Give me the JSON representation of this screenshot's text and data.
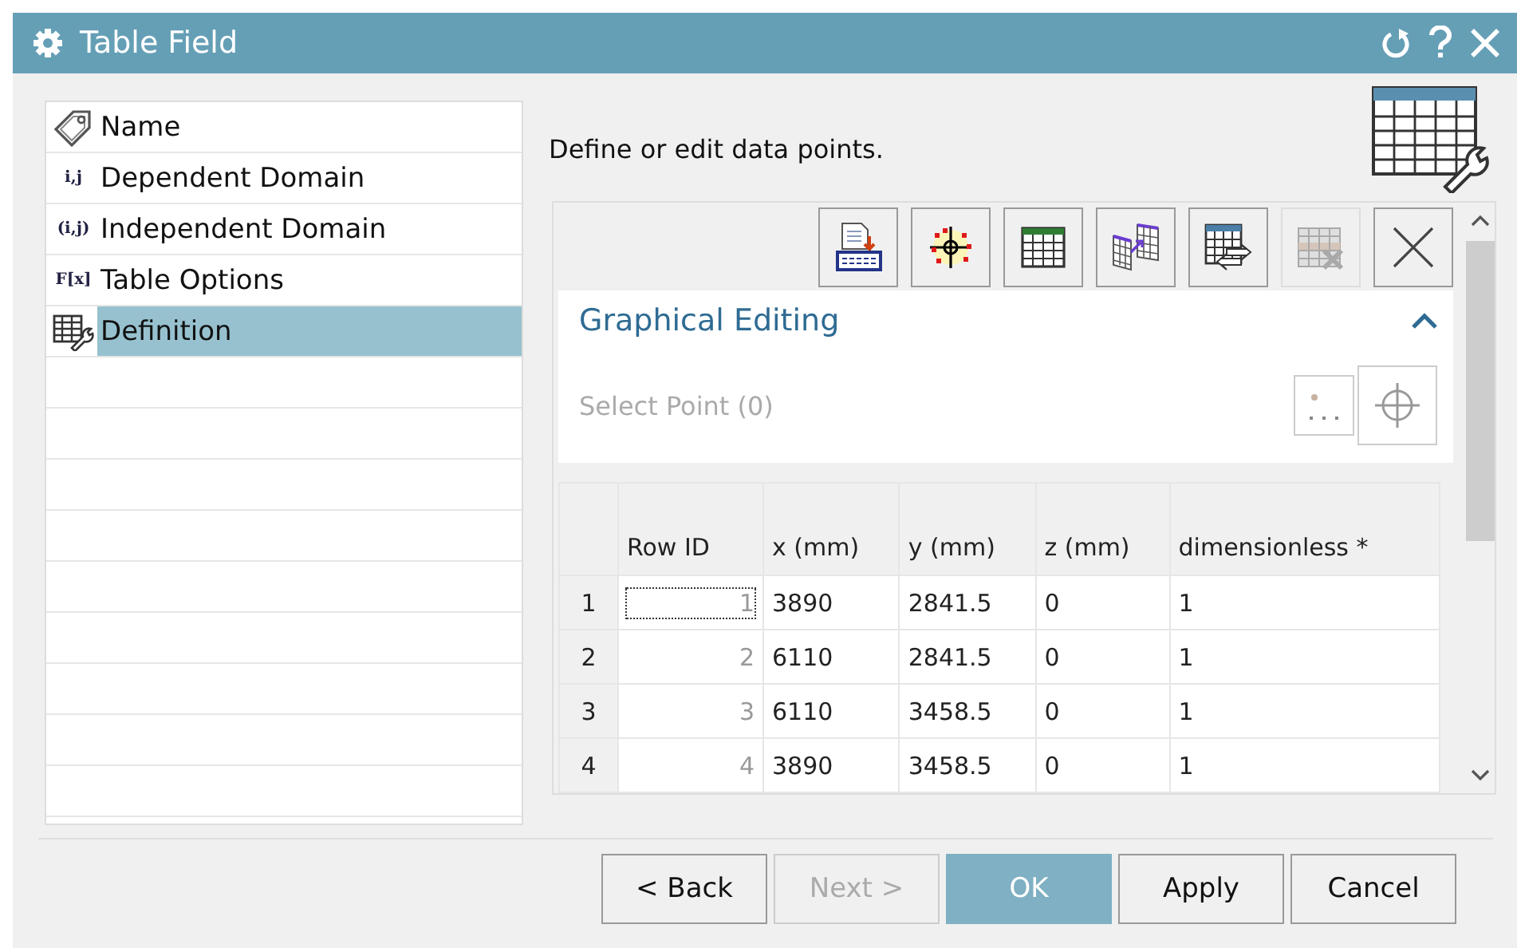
{
  "window": {
    "title": "Table Field"
  },
  "sidebar": {
    "items": [
      {
        "label": "Name",
        "kind": "tag",
        "selected": false
      },
      {
        "label": "Dependent Domain",
        "kind": "glyph",
        "glyph": "i,j",
        "selected": false
      },
      {
        "label": "Independent Domain",
        "kind": "glyph",
        "glyph": "(i,j)",
        "selected": false
      },
      {
        "label": "Table Options",
        "kind": "glyph",
        "glyph": "F[x]",
        "selected": false
      },
      {
        "label": "Definition",
        "kind": "table",
        "selected": true
      }
    ]
  },
  "description": "Define or edit data points.",
  "toolbar": [
    {
      "kind": "import",
      "disabled": false
    },
    {
      "kind": "points",
      "disabled": false
    },
    {
      "kind": "grid",
      "disabled": false
    },
    {
      "kind": "sheets",
      "disabled": false
    },
    {
      "kind": "export",
      "disabled": false
    },
    {
      "kind": "delete-rows",
      "disabled": true
    },
    {
      "kind": "close",
      "disabled": false
    }
  ],
  "section": {
    "title": "Graphical Editing",
    "expanded": true,
    "select_point": {
      "label": "Select Point (0)",
      "disabled": true
    }
  },
  "table": {
    "columns": [
      "Row ID",
      "x (mm)",
      "y (mm)",
      "z (mm)",
      "dimensionless *"
    ],
    "rows": [
      {
        "header": "1",
        "cells": [
          "1",
          "3890",
          "2841.5",
          "0",
          "1"
        ],
        "focused": true
      },
      {
        "header": "2",
        "cells": [
          "2",
          "6110",
          "2841.5",
          "0",
          "1"
        ],
        "focused": false
      },
      {
        "header": "3",
        "cells": [
          "3",
          "6110",
          "3458.5",
          "0",
          "1"
        ],
        "focused": false
      },
      {
        "header": "4",
        "cells": [
          "4",
          "3890",
          "3458.5",
          "0",
          "1"
        ],
        "focused": false
      }
    ]
  },
  "buttons": [
    {
      "label": "< Back",
      "disabled": false,
      "primary": false
    },
    {
      "label": "Next >",
      "disabled": true,
      "primary": false
    },
    {
      "label": "OK",
      "disabled": false,
      "primary": true
    },
    {
      "label": "Apply",
      "disabled": false,
      "primary": false
    },
    {
      "label": "Cancel",
      "disabled": false,
      "primary": false
    }
  ]
}
